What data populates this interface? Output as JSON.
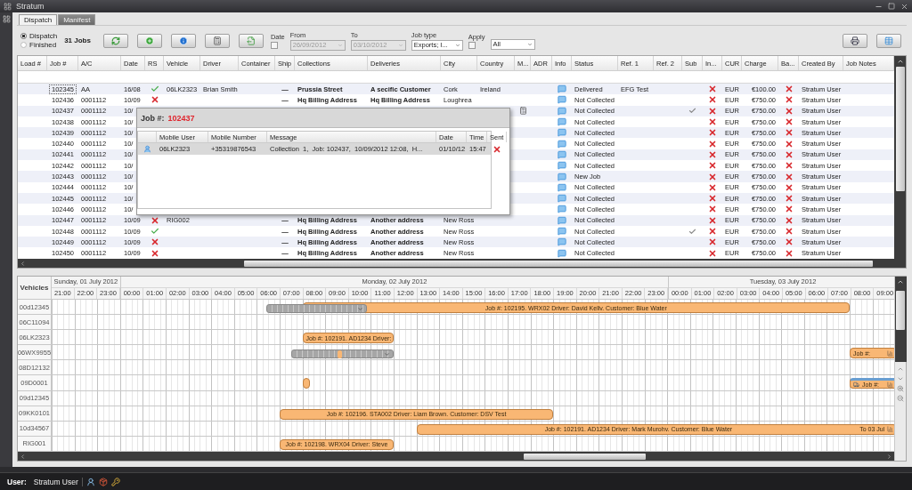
{
  "window": {
    "title": "Stratum"
  },
  "tabs": [
    {
      "label": "Dispatch",
      "selected": true
    },
    {
      "label": "Manifest",
      "selected": false
    }
  ],
  "toolbar": {
    "modes": [
      {
        "label": "Dispatch",
        "selected": true
      },
      {
        "label": "Finished",
        "selected": false
      }
    ],
    "job_count": "31 Jobs",
    "date_filter": {
      "label": "Date",
      "checked": false
    },
    "from": {
      "label": "From",
      "value": "26/09/2012",
      "disabled": true
    },
    "to": {
      "label": "To",
      "value": "03/10/2012",
      "disabled": true
    },
    "job_type": {
      "label": "Job type",
      "value": "Exports; I..."
    },
    "apply": {
      "label": "Apply",
      "checked": false
    },
    "apply_value": "All"
  },
  "table": {
    "columns": [
      "Load #",
      "Job #",
      "A/C",
      "Date",
      "RS",
      "Vehicle",
      "Driver",
      "Container",
      "Ship",
      "Collections",
      "Deliveries",
      "City",
      "Country",
      "M...",
      "ADR",
      "Info",
      "Status",
      "Ref. 1",
      "Ref. 2",
      "Sub",
      "In...",
      "CUR",
      "Charge",
      "Ba...",
      "Created By",
      "Job Notes"
    ],
    "rows": [
      {
        "selected": true,
        "job": "102345",
        "ac": "AA",
        "date": "16/08",
        "rs_ok": true,
        "vehicle": "06LK2323",
        "driver": "Brian Smith",
        "ship": "—",
        "collections": "Prussia Street",
        "deliveries": "A secific Customer",
        "city": "Cork",
        "country": "Ireland",
        "calc": false,
        "status": "Delivered",
        "ref1": "EFG Test",
        "sub": false,
        "invoiced": false,
        "cur": "EUR",
        "charge": "€100.00",
        "ba": false,
        "created_by": "Stratum User"
      },
      {
        "selected": false,
        "job": "102436",
        "ac": "0001112",
        "date": "10/09",
        "rs_ok": false,
        "ship": "—",
        "collections": "Hq Billing Address",
        "deliveries": "Hq Billing Address",
        "city": "Loughrea",
        "calc": false,
        "status": "Not Collected",
        "sub": false,
        "invoiced": false,
        "cur": "EUR",
        "charge": "€750.00",
        "ba": false,
        "created_by": "Stratum User"
      },
      {
        "selected": false,
        "job": "102437",
        "ac": "0001112",
        "date": "10/",
        "calc": true,
        "status": "Not Collected",
        "sub": true,
        "invoiced": false,
        "cur": "EUR",
        "charge": "€750.00",
        "ba": false,
        "created_by": "Stratum User"
      },
      {
        "selected": false,
        "job": "102438",
        "ac": "0001112",
        "date": "10/",
        "calc": false,
        "status": "Not Collected",
        "sub": false,
        "invoiced": false,
        "cur": "EUR",
        "charge": "€750.00",
        "ba": false,
        "created_by": "Stratum User"
      },
      {
        "selected": false,
        "job": "102439",
        "ac": "0001112",
        "date": "10/",
        "calc": false,
        "status": "Not Collected",
        "sub": false,
        "invoiced": false,
        "cur": "EUR",
        "charge": "€750.00",
        "ba": false,
        "created_by": "Stratum User"
      },
      {
        "selected": false,
        "job": "102440",
        "ac": "0001112",
        "date": "10/",
        "calc": false,
        "status": "Not Collected",
        "sub": false,
        "invoiced": false,
        "cur": "EUR",
        "charge": "€750.00",
        "ba": false,
        "created_by": "Stratum User"
      },
      {
        "selected": false,
        "job": "102441",
        "ac": "0001112",
        "date": "10/",
        "calc": false,
        "status": "Not Collected",
        "sub": false,
        "invoiced": false,
        "cur": "EUR",
        "charge": "€750.00",
        "ba": false,
        "created_by": "Stratum User"
      },
      {
        "selected": false,
        "job": "102442",
        "ac": "0001112",
        "date": "10/",
        "calc": false,
        "status": "Not Collected",
        "sub": false,
        "invoiced": false,
        "cur": "EUR",
        "charge": "€750.00",
        "ba": false,
        "created_by": "Stratum User"
      },
      {
        "selected": false,
        "job": "102443",
        "ac": "0001112",
        "date": "10/",
        "calc": false,
        "status": "New Job",
        "sub": false,
        "invoiced": false,
        "cur": "EUR",
        "charge": "€750.00",
        "ba": false,
        "created_by": "Stratum User"
      },
      {
        "selected": false,
        "job": "102444",
        "ac": "0001112",
        "date": "10/",
        "calc": false,
        "status": "Not Collected",
        "sub": false,
        "invoiced": false,
        "cur": "EUR",
        "charge": "€750.00",
        "ba": false,
        "created_by": "Stratum User"
      },
      {
        "selected": false,
        "job": "102445",
        "ac": "0001112",
        "date": "10/",
        "calc": false,
        "status": "Not Collected",
        "sub": false,
        "invoiced": false,
        "cur": "EUR",
        "charge": "€750.00",
        "ba": false,
        "created_by": "Stratum User"
      },
      {
        "selected": false,
        "job": "102446",
        "ac": "0001112",
        "date": "10/",
        "calc": false,
        "status": "Not Collected",
        "sub": false,
        "invoiced": false,
        "cur": "EUR",
        "charge": "€750.00",
        "ba": false,
        "created_by": "Stratum User"
      },
      {
        "selected": false,
        "job": "102447",
        "ac": "0001112",
        "date": "10/09",
        "rs_ok": false,
        "vehicle": "RIG002",
        "ship": "—",
        "collections": "Hq Billing Address",
        "deliveries": "Another address",
        "city": "New Ross",
        "calc": false,
        "status": "Not Collected",
        "sub": false,
        "invoiced": false,
        "cur": "EUR",
        "charge": "€750.00",
        "ba": false,
        "created_by": "Stratum User"
      },
      {
        "selected": false,
        "job": "102448",
        "ac": "0001112",
        "date": "10/09",
        "rs_ok": true,
        "ship": "—",
        "collections": "Hq Billing Address",
        "deliveries": "Another address",
        "city": "New Ross",
        "calc": false,
        "status": "Not Collected",
        "sub": true,
        "invoiced": false,
        "cur": "EUR",
        "charge": "€750.00",
        "ba": false,
        "created_by": "Stratum User"
      },
      {
        "selected": false,
        "job": "102449",
        "ac": "0001112",
        "date": "10/09",
        "rs_ok": false,
        "ship": "—",
        "collections": "Hq Billing Address",
        "deliveries": "Another address",
        "city": "New Ross",
        "calc": false,
        "status": "Not Collected",
        "sub": false,
        "invoiced": false,
        "cur": "EUR",
        "charge": "€750.00",
        "ba": false,
        "created_by": "Stratum User"
      },
      {
        "selected": false,
        "job": "102450",
        "ac": "0001112",
        "date": "10/09",
        "rs_ok": false,
        "ship": "—",
        "collections": "Hq Billing Address",
        "deliveries": "Another address",
        "city": "New Ross",
        "calc": false,
        "status": "Not Collected",
        "sub": false,
        "invoiced": false,
        "cur": "EUR",
        "charge": "€750.00",
        "ba": false,
        "created_by": "Stratum User"
      }
    ]
  },
  "popup": {
    "title": "Job #:",
    "job": "102437",
    "columns": [
      "Mobile User",
      "Mobile Number",
      "Message",
      "Date",
      "Time",
      "Sent"
    ],
    "rows": [
      {
        "mobile_user": "06LK2323",
        "mobile_number": "+35319876543",
        "message": "Collection  1,  Job: 102437,  10/09/2012 12:08,  H...",
        "date": "01/10/12",
        "time": "15:47",
        "sent": false
      }
    ]
  },
  "schedule": {
    "heading": "Vehicles",
    "days": [
      {
        "label": "Sunday, 01 July 2012",
        "hours": [
          "21:00",
          "22:00",
          "23:00"
        ]
      },
      {
        "label": "Monday, 02 July 2012",
        "hours": [
          "00:00",
          "01:00",
          "02:00",
          "03:00",
          "04:00",
          "05:00",
          "06:00",
          "07:00",
          "08:00",
          "09:00",
          "10:00",
          "11:00",
          "12:00",
          "13:00",
          "14:00",
          "15:00",
          "16:00",
          "17:00",
          "18:00",
          "19:00",
          "20:00",
          "21:00",
          "22:00",
          "23:00"
        ]
      },
      {
        "label": "Tuesday, 03 July 2012",
        "hours": [
          "00:00",
          "01:00",
          "02:00",
          "03:00",
          "04:00",
          "05:00",
          "06:00",
          "07:00",
          "08:00",
          "09:00"
        ]
      }
    ],
    "vehicles": [
      {
        "name": "00d12345",
        "bars": [
          {
            "kind": "job",
            "label": "Job #: 102195. WRX02 Driver: David Kellv. Customer: Blue Water",
            "flagged": false
          },
          {
            "kind": "group"
          }
        ]
      },
      {
        "name": "06C11094"
      },
      {
        "name": "06LK2323",
        "bars": [
          {
            "kind": "job",
            "label": "Job #: 102191. AD1234 Driver:",
            "flagged": false
          }
        ]
      },
      {
        "name": "06WX9955",
        "bars": [
          {
            "kind": "group"
          },
          {
            "kind": "job",
            "label": "Job #:",
            "flagged": false
          }
        ]
      },
      {
        "name": "08D12132"
      },
      {
        "name": "09D0001",
        "bars": [
          {
            "kind": "job",
            "flagged": false
          },
          {
            "kind": "job",
            "label": "Job #:",
            "flagged": true
          }
        ]
      },
      {
        "name": "09d12345"
      },
      {
        "name": "09KK0101",
        "bars": [
          {
            "kind": "job",
            "label": "Job #: 102196. STA002 Driver: Liam Brown. Customer: DSV Test",
            "flagged": false
          }
        ]
      },
      {
        "name": "10d34567",
        "bars": [
          {
            "kind": "job",
            "label": "Job #: 102191. AD1234 Driver: Mark Murohv. Customer: Blue Water",
            "tail": "To 03 Jul",
            "flagged": false
          }
        ]
      },
      {
        "name": "RIG001",
        "bars": [
          {
            "kind": "job",
            "label": "Job #: 102198. WRX04 Driver: Steve",
            "flagged": false
          }
        ]
      }
    ]
  },
  "status_bar": {
    "label": "User:",
    "user": "Stratum User"
  }
}
